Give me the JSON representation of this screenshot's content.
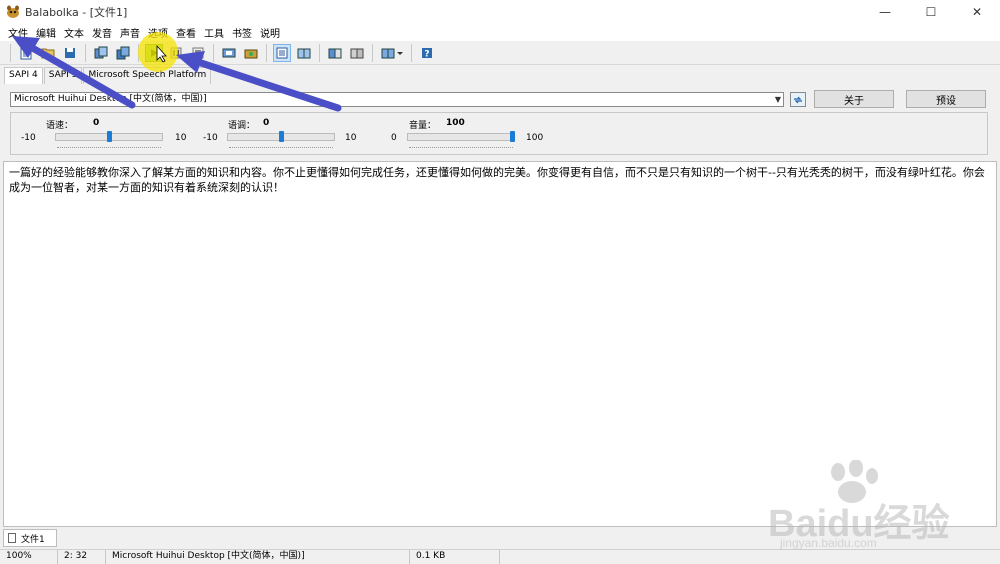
{
  "window": {
    "title": "Balabolka - [文件1]",
    "minimize": "—",
    "maximize": "☐",
    "close": "✕"
  },
  "menu": [
    "文件",
    "编辑",
    "文本",
    "发音",
    "声音",
    "选项",
    "查看",
    "工具",
    "书签",
    "说明"
  ],
  "toolbar_icons": [
    "new-file-icon",
    "open-file-icon",
    "save-file-icon",
    "convert-icon",
    "batch-icon",
    "play-icon",
    "pause-icon",
    "stop-icon",
    "read-clipboard-icon",
    "record-icon",
    "text-window-icon",
    "dictionary-icon",
    "pronunciation-icon",
    "split-icon",
    "view-icon",
    "help-icon"
  ],
  "tabs": [
    "SAPI 4",
    "SAPI 5",
    "Microsoft Speech Platform"
  ],
  "voice": {
    "selected": "Microsoft Huihui Desktop [中文(简体，中国)]",
    "about_label": "关于",
    "preset_label": "预设"
  },
  "sliders": [
    {
      "label": "语速：",
      "value": "0",
      "min": "-10",
      "max": "10",
      "level": 0.5
    },
    {
      "label": "语调：",
      "value": "0",
      "min": "-10",
      "max": "10",
      "level": 0.5
    },
    {
      "label": "音量：",
      "value": "100",
      "min": "0",
      "max": "100",
      "level": 1.0
    }
  ],
  "editor": {
    "text": "一篇好的经验能够教你深入了解某方面的知识和内容。你不止更懂得如何完成任务，还更懂得如何做的完美。你变得更有自信，而不只是只有知识的一个树干--只有光秃秃的树干，而没有绿叶红花。你会成为一位智者，对某一方面的知识有着系统深刻的认识！"
  },
  "doc_tab": {
    "label": "文件1"
  },
  "status": {
    "zoom": "100%",
    "position": "2:  32",
    "voice": "Microsoft Huihui Desktop [中文(简体，中国)]",
    "size": "0.1 KB"
  },
  "watermark": {
    "line1": "Baidu经验",
    "line2": "jingyan.baidu.com"
  },
  "colors": {
    "accent": "#1c7bd4",
    "highlight": "#f5e300",
    "arrow": "#4a4fc7",
    "play": "#8fcf6a"
  }
}
